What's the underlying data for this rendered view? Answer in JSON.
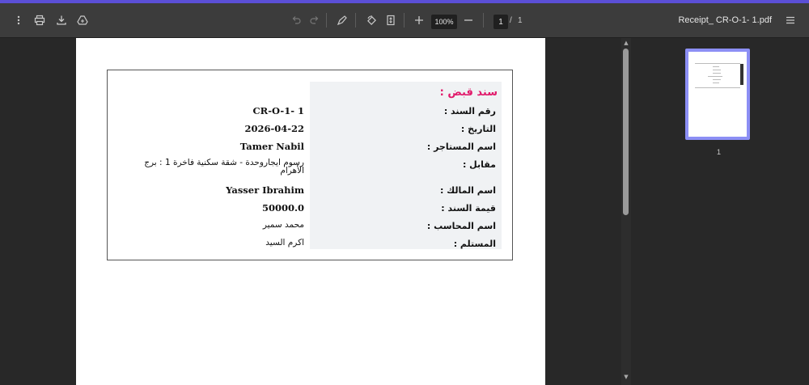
{
  "theme": {
    "accent": "#5b4fd6",
    "heading_color": "#e1196a",
    "thumb_border": "#8c8ff5"
  },
  "toolbar": {
    "menu_icon": "kebab-menu-icon",
    "print_icon": "printer-icon",
    "download_icon": "download-icon",
    "drive_icon": "drive-icon",
    "zoom_value": "100%",
    "page_current": "1",
    "page_separator": "/",
    "page_total": "1",
    "document_title": "Receipt_ CR-O-1- 1.pdf"
  },
  "receipt": {
    "heading": "سند قبض :",
    "rows": [
      {
        "label": "رقم السند :",
        "value": "CR-O-1- 1"
      },
      {
        "label": "التاريخ :",
        "value": "2026-04-22"
      },
      {
        "label": "اسم المستاجر :",
        "value": "Tamer Nabil"
      },
      {
        "label": "مقابل :",
        "value": "رسوم ايجاروحدة - شقة سكنية فاخرة 1 : برج الأهرام"
      },
      {
        "label": "اسم المالك :",
        "value": "Yasser Ibrahim"
      },
      {
        "label": "قيمة السند :",
        "value": "50000.0"
      },
      {
        "label": "اسم المحاسب :",
        "value": "محمد سمير"
      },
      {
        "label": "المستلم :",
        "value": "اكرم السيد"
      }
    ]
  },
  "sidebar": {
    "thumbnail_page_number": "1"
  }
}
